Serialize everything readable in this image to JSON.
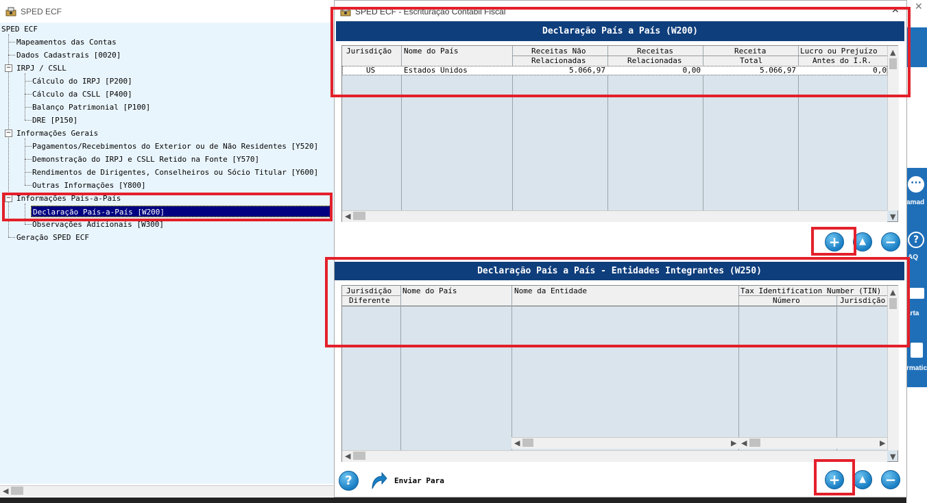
{
  "left_window": {
    "title": "SPED ECF",
    "tree": [
      {
        "label": "SPED ECF",
        "level": 0
      },
      {
        "label": "Mapeamentos das Contas",
        "level": 1
      },
      {
        "label": "Dados Cadastrais [0020]",
        "level": 1
      },
      {
        "label": "IRPJ / CSLL",
        "level": 1,
        "expander": "−"
      },
      {
        "label": "Cálculo do IRPJ [P200]",
        "level": 2
      },
      {
        "label": "Cálculo da CSLL [P400]",
        "level": 2
      },
      {
        "label": "Balanço Patrimonial [P100]",
        "level": 2
      },
      {
        "label": "DRE [P150]",
        "level": 2
      },
      {
        "label": "Informações Gerais",
        "level": 1,
        "expander": "−"
      },
      {
        "label": "Pagamentos/Recebimentos do Exterior ou de Não Residentes [Y520]",
        "level": 2
      },
      {
        "label": "Demonstração do IRPJ e CSLL Retido na Fonte [Y570]",
        "level": 2
      },
      {
        "label": "Rendimentos de Dirigentes, Conselheiros ou Sócio Titular [Y600]",
        "level": 2
      },
      {
        "label": "Outras Informações [Y800]",
        "level": 2
      },
      {
        "label": "Informações País-a-País",
        "level": 1,
        "expander": "−"
      },
      {
        "label": "Declaração País-a-País [W200]",
        "level": 2,
        "selected": true
      },
      {
        "label": "Observações Adicionais [W300]",
        "level": 2
      },
      {
        "label": "Geração SPED ECF",
        "level": 1
      }
    ]
  },
  "dialog": {
    "title": "SPED ECF  -  Escrituração Contábil Fiscal",
    "close_glyph": "✕",
    "w200": {
      "header": "Declaração País a País  (W200)",
      "columns": [
        {
          "top": "Jurisdição",
          "bottom": ""
        },
        {
          "top": "Nome do País",
          "bottom": ""
        },
        {
          "top": "Receitas Não",
          "bottom": "Relacionadas"
        },
        {
          "top": "Receitas",
          "bottom": "Relacionadas"
        },
        {
          "top": "Receita",
          "bottom": "Total"
        },
        {
          "top": "Lucro ou Prejuízo",
          "bottom": "Antes do I.R."
        }
      ],
      "rows": [
        {
          "jurisdicao": "US",
          "pais": "Estados Unidos",
          "rec_nao_rel": "5.066,97",
          "rec_rel": "0,00",
          "rec_total": "5.066,97",
          "lucro": "0,0"
        }
      ]
    },
    "w250": {
      "header": "Declaração País a País - Entidades Integrantes  (W250)",
      "columns": [
        {
          "top": "Jurisdição",
          "bottom": "Diferente"
        },
        {
          "top": "Nome do País",
          "bottom": ""
        },
        {
          "top": "Nome da Entidade",
          "bottom": ""
        },
        {
          "top": "Tax Identification Number (TIN)",
          "bottom": "Número"
        },
        {
          "top": "",
          "bottom": "Jurisdição"
        }
      ]
    },
    "footer": {
      "help_glyph": "?",
      "send_label": "Enviar Para"
    },
    "buttons": {
      "add": "+",
      "up": "▲",
      "remove": "−"
    }
  },
  "background_app": {
    "labels": [
      "amad",
      "AQ",
      "arta",
      "rmatic"
    ]
  },
  "colors": {
    "header_blue": "#0f3e7c",
    "grid_bg": "#d9e4ec",
    "highlight": "#e3202a",
    "selection": "#000080"
  }
}
